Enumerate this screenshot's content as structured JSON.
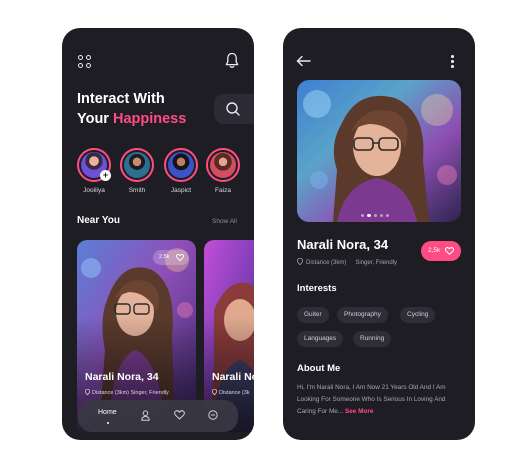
{
  "left": {
    "headline_line1": "Interact With",
    "headline_line2_prefix": "Your ",
    "headline_line2_accent": "Happiness",
    "stories": [
      {
        "name": "Jooiliya"
      },
      {
        "name": "Smith"
      },
      {
        "name": "Jaspict"
      },
      {
        "name": "Faiza"
      }
    ],
    "story_add_symbol": "+",
    "section_title": "Near You",
    "show_all": "Show All",
    "cards": [
      {
        "name": "Narali Nora, 34",
        "meta": "Distance (3km)    Singer, Friendly",
        "likes": "2,5k"
      },
      {
        "name": "Narali No",
        "meta": "Distance (3k"
      }
    ],
    "nav": {
      "home": "Home"
    }
  },
  "right": {
    "profile_name": "Narali Nora, 34",
    "distance": "Distance (3km)",
    "tags": "Singer, Friendly",
    "likes": "2,5k",
    "interests_title": "Interests",
    "interests": [
      "Guiter",
      "Photography",
      "Cycling",
      "Languages",
      "Running"
    ],
    "about_title": "About Me",
    "about_text": "Hi, I'm Narali Nora, I Am Now 21 Years Old And I Am Looking For Someone Who Is Serious In Loving And Caring For Me... ",
    "see_more": "See More"
  },
  "colors": {
    "background": "#1e1d24",
    "accent": "#ff4d83",
    "chip": "#2f2e38"
  },
  "icons": [
    "grid-icon",
    "bell-icon",
    "search-icon",
    "heart-icon",
    "home-icon",
    "user-icon",
    "chat-icon",
    "back-arrow-icon",
    "more-vertical-icon",
    "location-pin-icon"
  ]
}
